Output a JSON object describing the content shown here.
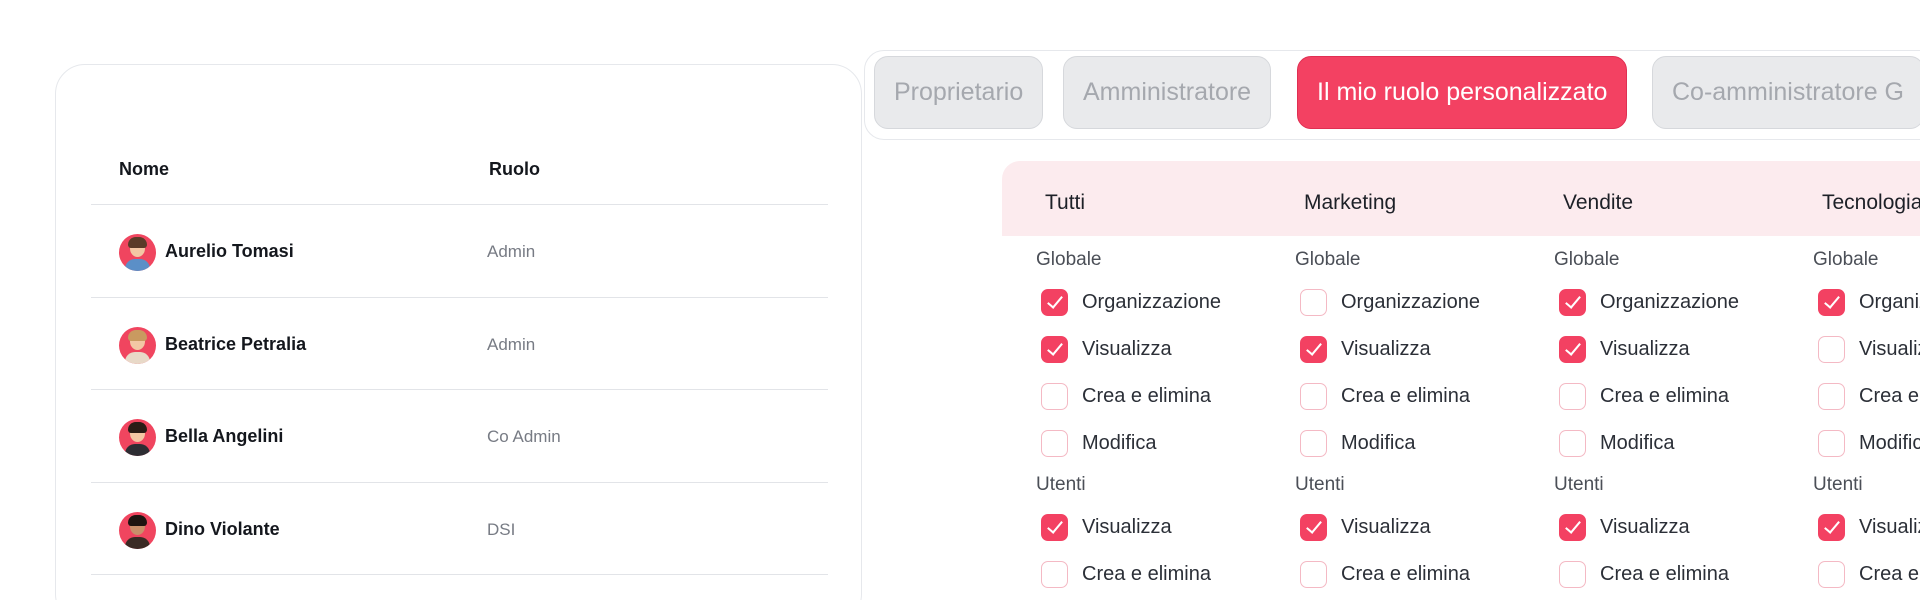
{
  "users_table": {
    "headers": {
      "name": "Nome",
      "role": "Ruolo"
    },
    "rows": [
      {
        "name": "Aurelio Tomasi",
        "role": "Admin"
      },
      {
        "name": "Beatrice Petralia",
        "role": "Admin"
      },
      {
        "name": "Bella Angelini",
        "role": "Co Admin"
      },
      {
        "name": "Dino Violante",
        "role": "DSI"
      }
    ]
  },
  "tabs": [
    {
      "label": "Proprietario",
      "active": false
    },
    {
      "label": "Amministratore",
      "active": false
    },
    {
      "label": "Il mio ruolo personalizzato",
      "active": true
    },
    {
      "label": "Co-amministratore G",
      "active": false
    }
  ],
  "permissions": {
    "columns": [
      {
        "title": "Tutti",
        "global_label": "Globale",
        "global": [
          {
            "label": "Organizzazione",
            "checked": true
          },
          {
            "label": "Visualizza",
            "checked": true
          },
          {
            "label": "Crea e elimina",
            "checked": false
          },
          {
            "label": "Modifica",
            "checked": false
          }
        ],
        "users_label": "Utenti",
        "users": [
          {
            "label": "Visualizza",
            "checked": true
          },
          {
            "label": "Crea e elimina",
            "checked": false
          }
        ]
      },
      {
        "title": "Marketing",
        "global_label": "Globale",
        "global": [
          {
            "label": "Organizzazione",
            "checked": false
          },
          {
            "label": "Visualizza",
            "checked": true
          },
          {
            "label": "Crea e elimina",
            "checked": false
          },
          {
            "label": "Modifica",
            "checked": false
          }
        ],
        "users_label": "Utenti",
        "users": [
          {
            "label": "Visualizza",
            "checked": true
          },
          {
            "label": "Crea e elimina",
            "checked": false
          }
        ]
      },
      {
        "title": "Vendite",
        "global_label": "Globale",
        "global": [
          {
            "label": "Organizzazione",
            "checked": true
          },
          {
            "label": "Visualizza",
            "checked": true
          },
          {
            "label": "Crea e elimina",
            "checked": false
          },
          {
            "label": "Modifica",
            "checked": false
          }
        ],
        "users_label": "Utenti",
        "users": [
          {
            "label": "Visualizza",
            "checked": true
          },
          {
            "label": "Crea e elimina",
            "checked": false
          }
        ]
      },
      {
        "title": "Tecnologia",
        "global_label": "Globale",
        "global": [
          {
            "label": "Organizzazione",
            "checked": true
          },
          {
            "label": "Visualizza",
            "checked": false
          },
          {
            "label": "Crea e elimina",
            "checked": false
          },
          {
            "label": "Modifica",
            "checked": false
          }
        ],
        "users_label": "Utenti",
        "users": [
          {
            "label": "Visualizza",
            "checked": true
          },
          {
            "label": "Crea e elimina",
            "checked": false
          }
        ]
      }
    ]
  },
  "colors": {
    "accent": "#f34162",
    "header_tint": "#fcebee",
    "checkbox_border": "#f4b9c4",
    "muted_text": "#777b84"
  }
}
